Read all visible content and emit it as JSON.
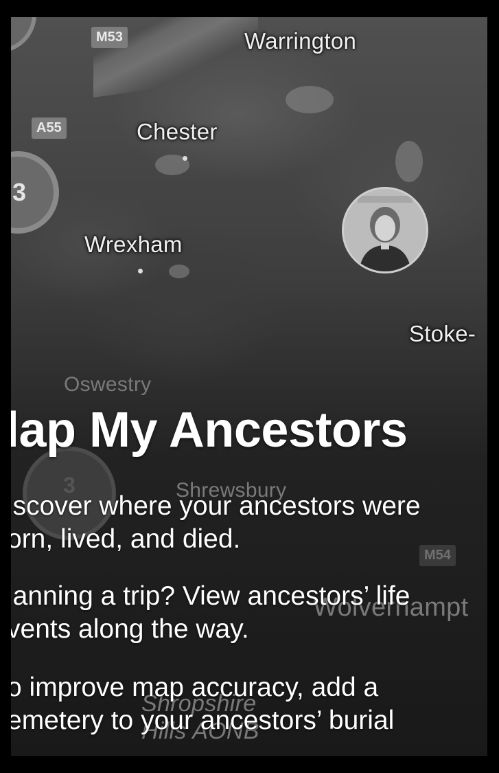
{
  "map": {
    "places": {
      "warrington": "Warrington",
      "chester": "Chester",
      "wrexham": "Wrexham",
      "stoke": "Stoke-",
      "oswestry": "Oswestry",
      "shrewsbury": "Shrewsbury",
      "wolverhampton": "Wolverhampt",
      "shropshire_line1": "Shropshire",
      "shropshire_line2": "Hills AONB"
    },
    "roads": {
      "m53": "M53",
      "a55": "A55",
      "m54": "M54"
    },
    "clusters": {
      "left_middle": "3",
      "lower_left": "3"
    }
  },
  "overlay": {
    "title": "lap My Ancestors",
    "paragraphs": [
      "iscover where your ancestors were\norn, lived, and died.",
      "lanning a trip? View ancestors’ life\nvents along the way.",
      "o improve map accuracy, add a\nemetery to your ancestors’ burial"
    ]
  },
  "colors": {
    "background": "#000000",
    "map_dark": "#1e1e1e",
    "text": "#ffffff"
  }
}
